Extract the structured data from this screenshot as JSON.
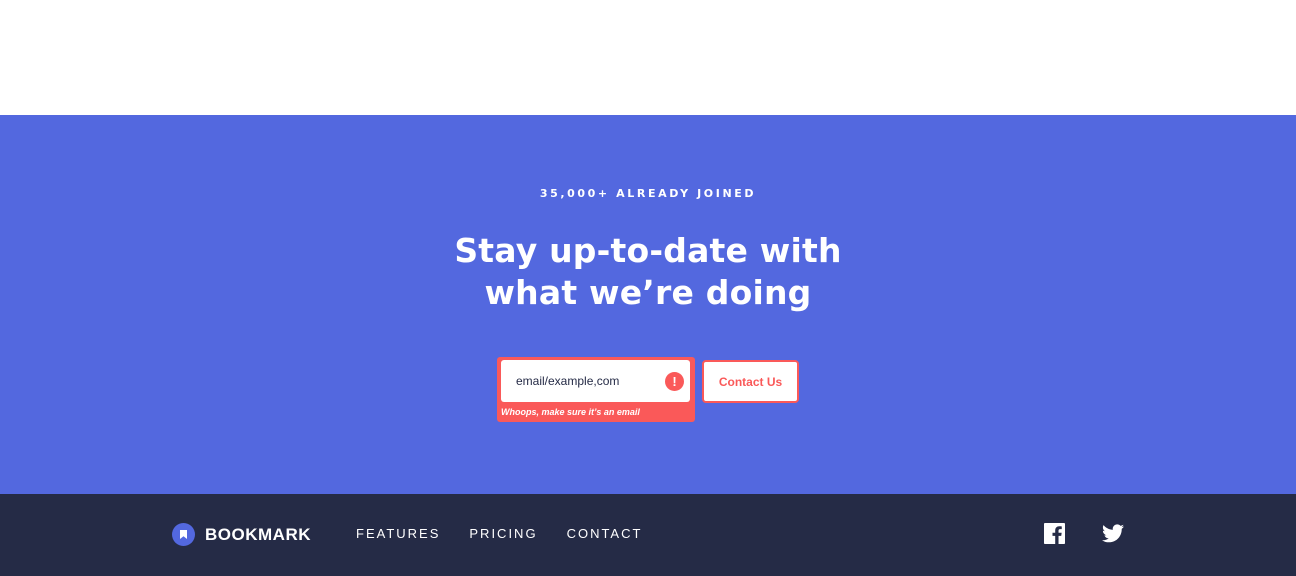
{
  "cta": {
    "eyebrow": "35,000+ ALREADY JOINED",
    "heading_line1": "Stay up-to-date with",
    "heading_line2": "what we’re doing",
    "email_value": "email/example,com",
    "error_icon_glyph": "!",
    "error_message": "Whoops, make sure it’s an email",
    "button_label": "Contact Us"
  },
  "footer": {
    "logo_text": "BOOKMARK",
    "nav": [
      {
        "label": "FEATURES"
      },
      {
        "label": "PRICING"
      },
      {
        "label": "CONTACT"
      }
    ],
    "social": [
      {
        "icon": "facebook-icon"
      },
      {
        "icon": "twitter-icon"
      }
    ]
  },
  "colors": {
    "primary": "#5368df",
    "error": "#fa5959",
    "dark": "#252b46",
    "white": "#ffffff"
  }
}
